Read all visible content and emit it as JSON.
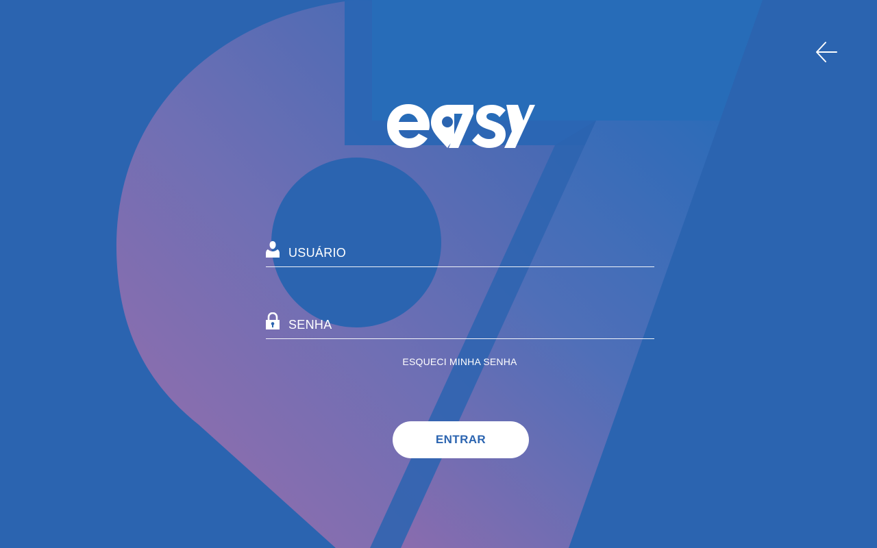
{
  "app": {
    "logo_text": "eaSY",
    "logo_alt": "easy"
  },
  "navigation": {
    "back_icon": "arrow-left-icon"
  },
  "login": {
    "username_placeholder": "USUÁRIO",
    "username_icon": "user-icon",
    "password_placeholder": "SENHA",
    "password_icon": "lock-icon",
    "forgot_password": "ESQUECI MINHA SENHA",
    "submit_label": "ENTRAR"
  },
  "colors": {
    "background": "#2b64b0",
    "accent_gradient_start": "#8f6aac",
    "accent_gradient_end": "#3f6eb8",
    "button_bg": "#ffffff",
    "button_text": "#2b64b0",
    "text": "#ffffff"
  }
}
